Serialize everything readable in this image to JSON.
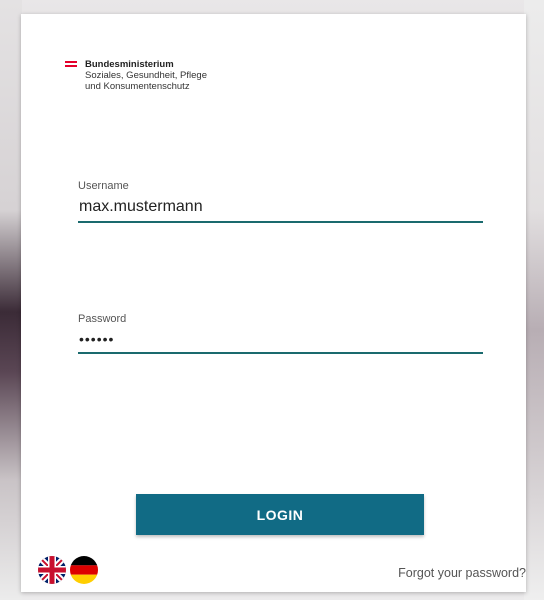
{
  "logo": {
    "line1": "Bundesministerium",
    "line2": "Soziales, Gesundheit, Pflege",
    "line3": "und Konsumentenschutz",
    "accent_color": "#e4002b"
  },
  "form": {
    "username": {
      "label": "Username",
      "value": "max.mustermann"
    },
    "password": {
      "label": "Password",
      "value": "••••••"
    },
    "login_label": "LOGIN",
    "field_underline_color": "#1a6a6e",
    "button_color": "#116b85"
  },
  "footer": {
    "languages": [
      {
        "icon": "uk-flag-icon"
      },
      {
        "icon": "german-flag-icon"
      }
    ],
    "forgot_password": "Forgot your password?"
  }
}
